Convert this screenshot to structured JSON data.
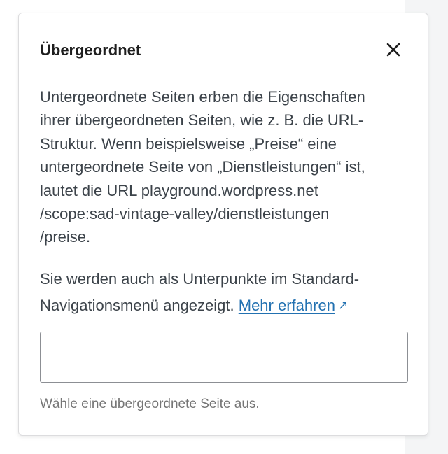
{
  "popover": {
    "title": "Übergeordnet",
    "close_icon": "close-icon",
    "description_lines": [
      "Untergeordnete Seiten erben die Eigenschaften",
      "ihrer übergeordneten Seiten, wie z. B. die URL-",
      "Struktur. Wenn beispielsweise „Preise“ eine",
      "untergeordnete Seite von „Dienstleistungen“ ist,",
      "lautet die URL playground.wordpress.net",
      "/scope:sad-vintage-valley/dienstleistungen",
      "/preise."
    ],
    "navigation_note_line1": "Sie werden auch als Unterpunkte im Standard-",
    "navigation_note_line2": "Navigationsmenü angezeigt.",
    "learn_more_label": "Mehr erfahren",
    "external_link_icon": "external-link-icon",
    "external_link_glyph": "↗",
    "parent_page_input": {
      "value": "",
      "placeholder": ""
    },
    "help_text": "Wähle eine übergeordnete Seite aus."
  },
  "colors": {
    "link": "#2271b1",
    "text": "#3c434a",
    "title": "#1e1e1e",
    "help": "#757575",
    "border": "#8c8f94"
  }
}
